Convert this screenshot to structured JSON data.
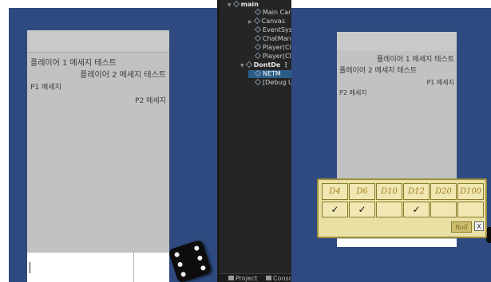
{
  "left_chat": {
    "messages": [
      "플레이어 1 메세지 테스트",
      "플레이어 2 메세지 테스트",
      "P1 메세지",
      "P2 메세지"
    ]
  },
  "hierarchy": {
    "items": [
      {
        "label": "main",
        "kind": "scene"
      },
      {
        "label": "Main Car",
        "kind": "object"
      },
      {
        "label": "Canvas",
        "kind": "object"
      },
      {
        "label": "EventSys",
        "kind": "object"
      },
      {
        "label": "ChatMan",
        "kind": "object"
      },
      {
        "label": "Player(Cl",
        "kind": "object"
      },
      {
        "label": "Player(Cl",
        "kind": "object"
      },
      {
        "label": "DontDe",
        "kind": "scene"
      },
      {
        "label": "NETM",
        "kind": "object",
        "selected": true
      },
      {
        "label": "[Debug U",
        "kind": "object"
      }
    ],
    "tabs": [
      "Project",
      "Console"
    ]
  },
  "right_chat": {
    "messages": [
      "플레이어 1 메세지 테스트",
      "플레이어 2 메세지 테스트",
      "P1 메세지",
      "P2 메세지"
    ]
  },
  "dice_panel": {
    "dice": [
      "D4",
      "D6",
      "D10",
      "D12",
      "D20",
      "D100"
    ],
    "checked": [
      true,
      true,
      false,
      true,
      false,
      false
    ],
    "check_mark": "✓",
    "roll_label": "Roll",
    "close_label": "X"
  },
  "colors": {
    "game_background": "#2e4a80",
    "chat_panel": "#c2c2c2",
    "dice_panel": "#e9e0a4",
    "hierarchy_background": "#252525"
  }
}
